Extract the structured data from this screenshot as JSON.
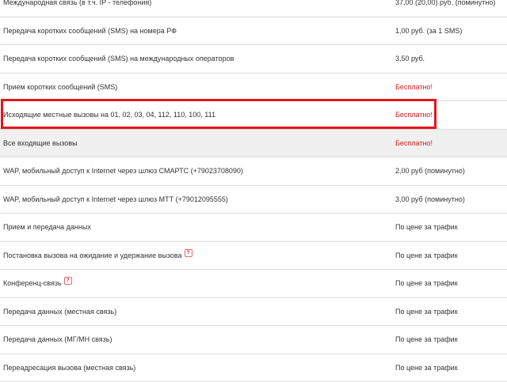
{
  "rows": [
    {
      "name": "Международная связь (в т.ч. IP - телефония)",
      "price": "37,00 (20,00) руб. (поминутно)",
      "free": false,
      "help": false
    },
    {
      "name": "Передача коротких сообщений (SMS) на номера РФ",
      "price": "1,00 руб. (за 1 SMS)",
      "free": false,
      "help": false
    },
    {
      "name": "Передача коротких сообщений (SMS) на международных операторов",
      "price": "3,50 руб.",
      "free": false,
      "help": false
    },
    {
      "name": "Прием коротких сообщений (SMS)",
      "price": "Бесплатно!",
      "free": true,
      "help": false
    },
    {
      "name": "Исходящие местные вызовы на 01, 02, 03, 04, 112, 110, 100, 111",
      "price": "Бесплатно!",
      "free": true,
      "help": false
    },
    {
      "name": "Все входящие вызовы",
      "price": "Бесплатно!",
      "free": true,
      "help": false
    },
    {
      "name": "WAP, мобильный доступ к Internet через шлюз СМАРТС (+79023708090)",
      "price": "2,00 руб (поминутно)",
      "free": false,
      "help": false
    },
    {
      "name": "WAP, мобильный доступ к Internet через шлюз МТТ (+79012095555)",
      "price": "3,00 руб (поминутно)",
      "free": false,
      "help": false
    },
    {
      "name": "Прием и передача данных",
      "price": "По цене за трафик",
      "free": false,
      "help": false
    },
    {
      "name": "Постановка вызова на ожидание и удержание вызова",
      "price": "По цене за трафик",
      "free": false,
      "help": true
    },
    {
      "name": "Конференц-связь",
      "price": "По цене за трафик",
      "free": false,
      "help": true
    },
    {
      "name": "Передача данных (местная связь)",
      "price": "По цене за трафик",
      "free": false,
      "help": false
    },
    {
      "name": "Передача данных (МГ/МН связь)",
      "price": "По цене за трафик",
      "free": false,
      "help": false
    },
    {
      "name": "Переадресация вызова (местная связь)",
      "price": "По цене за трафик",
      "free": false,
      "help": false
    }
  ],
  "help_glyph": "?",
  "colors": {
    "free_text": "#d71920",
    "highlight_border": "#e8141c",
    "shaded_row": "#f0f0f0",
    "row_divider": "#dcdcdc"
  },
  "highlighted_row": 4,
  "shaded_row": 5
}
